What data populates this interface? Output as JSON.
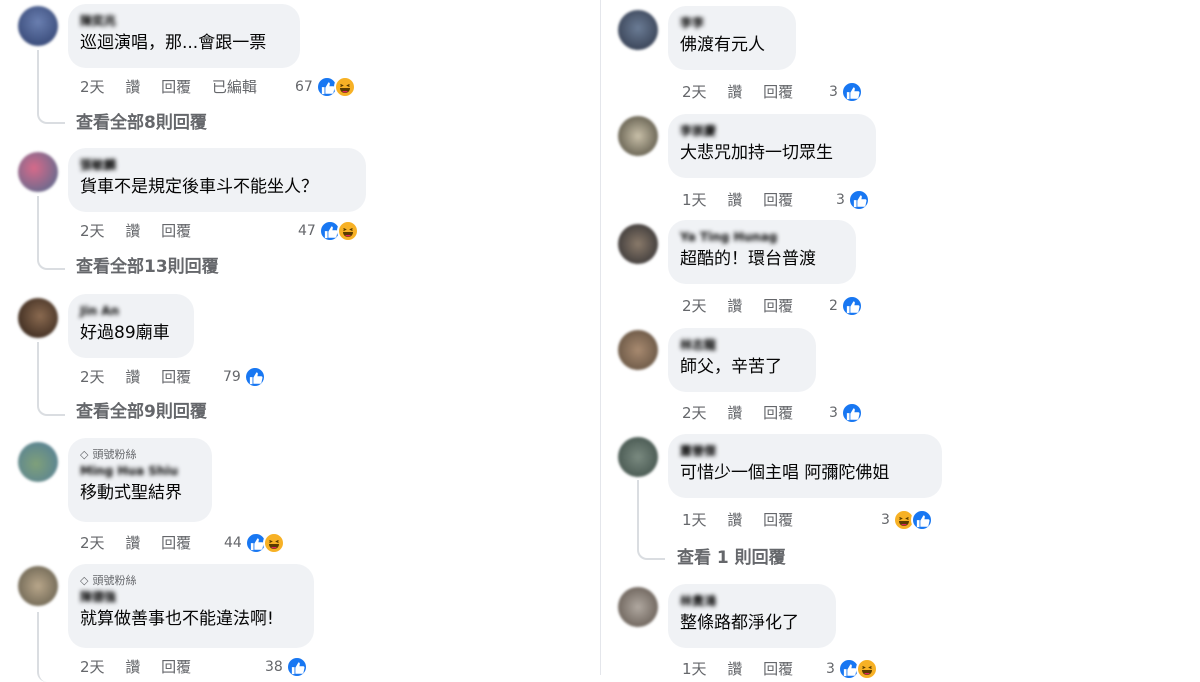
{
  "actions": {
    "like": "讚",
    "reply": "回覆",
    "edited": "已編輯"
  },
  "badge_label": "頭號粉絲",
  "left": [
    {
      "name": "陳奕兆",
      "text": "巡迴演唱，那...會跟一票",
      "time": "2天",
      "edited": true,
      "count": "67",
      "reactions": [
        "like",
        "haha"
      ],
      "view": "查看全部8則回覆"
    },
    {
      "name": "張敏麟",
      "text": "貨車不是規定後車斗不能坐人？",
      "time": "2天",
      "count": "47",
      "reactions": [
        "like",
        "haha"
      ],
      "view": "查看全部13則回覆"
    },
    {
      "name": "Jin An",
      "text": "好過89廟車",
      "time": "2天",
      "count": "79",
      "reactions": [
        "like"
      ],
      "view": "查看全部9則回覆"
    },
    {
      "name": "Ming Hua Shiu",
      "badge": true,
      "text": "移動式聖結界",
      "time": "2天",
      "count": "44",
      "reactions": [
        "like",
        "haha"
      ]
    },
    {
      "name": "陳德強",
      "badge": true,
      "text": "就算做善事也不能違法啊!",
      "time": "2天",
      "count": "38",
      "reactions": [
        "like"
      ]
    }
  ],
  "right": [
    {
      "name": "李李",
      "text": "佛渡有元人",
      "time": "2天",
      "count": "3",
      "reactions": [
        "like"
      ]
    },
    {
      "name": "李崇慶",
      "text": "大悲咒加持一切眾生",
      "time": "1天",
      "count": "3",
      "reactions": [
        "like"
      ]
    },
    {
      "name": "Ya Ting Hunag",
      "text": "超酷的！環台普渡",
      "time": "2天",
      "count": "2",
      "reactions": [
        "like"
      ]
    },
    {
      "name": "林志龍",
      "text": "師父，辛苦了",
      "time": "2天",
      "count": "3",
      "reactions": [
        "like"
      ]
    },
    {
      "name": "蕭晉傑",
      "text": "可惜少一個主唱 阿彌陀佛姐",
      "time": "1天",
      "count": "3",
      "reactions": [
        "haha",
        "like"
      ],
      "view": "查看 1 則回覆"
    },
    {
      "name": "林貴鴻",
      "text": "整條路都淨化了",
      "time": "1天",
      "count": "3",
      "reactions": [
        "like",
        "haha"
      ]
    }
  ],
  "colors": {
    "like": "#1877f2",
    "haha": "#f7b125",
    "bubble": "#f0f2f5",
    "meta": "#65676b"
  }
}
